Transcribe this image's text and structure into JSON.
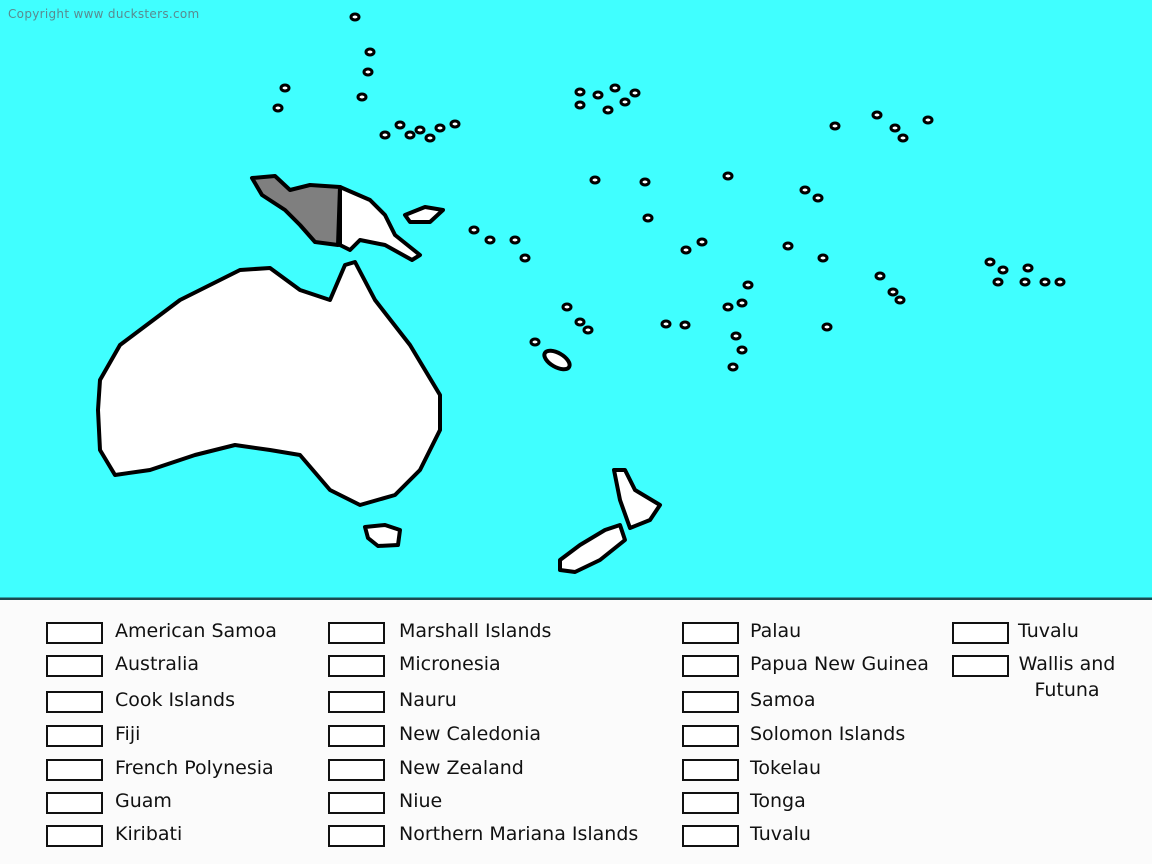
{
  "copyright": "Copyright www ducksters.com",
  "colors": {
    "ocean": "#40ffff",
    "land": "#ffffff",
    "highlight": "#7f7f7f",
    "outline": "#000000"
  },
  "highlighted_country": "Papua New Guinea (western half: Indonesia region shaded gray)",
  "legend": [
    [
      "American Samoa",
      "Australia",
      "Cook Islands",
      "Fiji",
      "French Polynesia",
      "Guam",
      "Kiribati"
    ],
    [
      "Marshall Islands",
      "Micronesia",
      "Nauru",
      "New Caledonia",
      "New Zealand",
      "Niue",
      "Northern Mariana Islands"
    ],
    [
      "Palau",
      "Papua New Guinea",
      "Samoa",
      "Solomon Islands",
      "Tokelau",
      "Tonga",
      "Tuvalu"
    ],
    [
      "Tuvalu",
      "Wallis and Futuna"
    ]
  ]
}
